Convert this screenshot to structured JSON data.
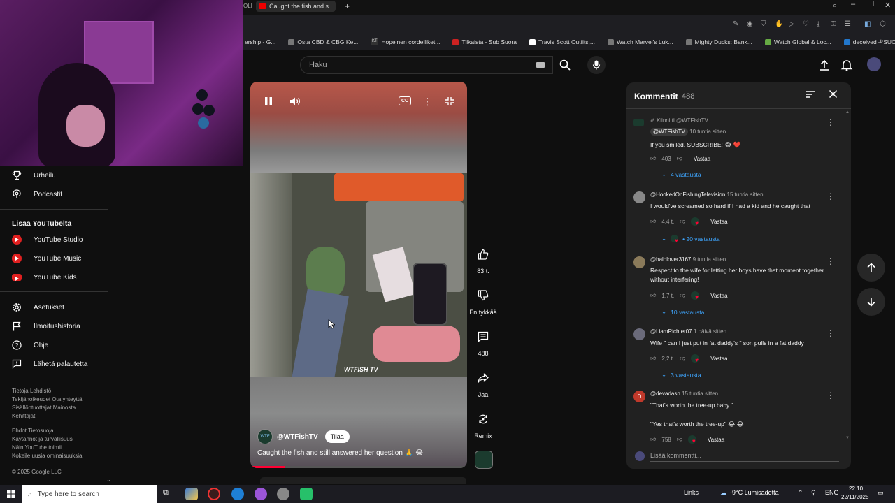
{
  "browser": {
    "tab_fragment": "OLI",
    "active_tab": "Caught the fish and s",
    "bookmarks": [
      "ership - G...",
      "Osta CBD & CBG Ke...",
      "Hopeinen cordelliket...",
      "Tilkaista - Sub Suora",
      "Travis Scott Outfits,...",
      "Watch Marvel's Luk...",
      "Mighty Ducks: Bank...",
      "Watch Global & Loc...",
      "deceived – SUORAT..."
    ],
    "bookmark_icons": [
      "",
      "",
      "KT",
      "",
      "",
      "",
      "",
      "",
      ""
    ]
  },
  "header": {
    "search_placeholder": "Haku"
  },
  "sidebar": {
    "top_items": [
      {
        "label": "Urheilu",
        "icon": "trophy-icon"
      },
      {
        "label": "Podcastit",
        "icon": "podcast-icon"
      }
    ],
    "more_heading": "Lisää YouTubelta",
    "more_items": [
      {
        "label": "YouTube Studio"
      },
      {
        "label": "YouTube Music"
      },
      {
        "label": "YouTube Kids"
      }
    ],
    "settings_items": [
      {
        "label": "Asetukset",
        "icon": "gear-icon"
      },
      {
        "label": "Ilmoitushistoria",
        "icon": "flag-icon"
      },
      {
        "label": "Ohje",
        "icon": "help-icon"
      },
      {
        "label": "Lähetä palautetta",
        "icon": "feedback-icon"
      }
    ],
    "footer_1": [
      "Tietoja  Lehdistö",
      "Tekijänoikeudet  Ota yhteyttä",
      "Sisällöntuottajat  Mainosta",
      "Kehittäjät"
    ],
    "footer_2": [
      "Ehdot  Tietosuoja",
      "Käytännöt ja turvallisuus",
      "Näin YouTube toimii",
      "Kokeile uusia ominaisuuksia"
    ],
    "copyright": "© 2025 Google LLC"
  },
  "video": {
    "cc_label": "CC",
    "watermark": "WTFISH TV",
    "channel_name": "@WTFishTV",
    "subscribe_label": "Tilaa",
    "title": "Caught the fish and still answered her question 🙏 😂",
    "progress": 0.16
  },
  "actions": {
    "likes": "83 t.",
    "dislike_label": "En tykkää",
    "comments": "488",
    "share_label": "Jaa",
    "remix_label": "Remix"
  },
  "comments": {
    "title": "Kommentit",
    "count": "488",
    "input_placeholder": "Lisää kommentti...",
    "items": [
      {
        "pinned": "Kiinnitti @WTFishTV",
        "author": "@WTFishTV",
        "time": "10 tuntia sitten",
        "text": "If you smiled, SUBSCRIBE! 😂 ❤️",
        "likes": "403",
        "reply_label": "Vastaa",
        "replies": "4 vastausta"
      },
      {
        "author": "@HookedOnFishingTelevision",
        "time": "15 tuntia sitten",
        "text": "I would've screamed so hard if I had a kid and he caught that",
        "likes": "4,4 t.",
        "reply_label": "Vastaa",
        "replies": "• 20 vastausta"
      },
      {
        "author": "@halolover3167",
        "time": "9 tuntia sitten",
        "text": "Respect to the wife for letting her boys have that moment together without interfering!",
        "likes": "1,7 t.",
        "reply_label": "Vastaa",
        "replies": "10 vastausta"
      },
      {
        "author": "@LiamRichter07",
        "time": "1 päivä sitten",
        "text": "Wife \" can I just put in fat daddy's \" son pulls in a fat daddy",
        "likes": "2,2 t.",
        "reply_label": "Vastaa",
        "replies": "3 vastausta"
      },
      {
        "author": "@devadasn",
        "avatar_letter": "D",
        "time": "15 tuntia sitten",
        "text": "\"That's worth the tree-up baby.\"",
        "text2": "\"Yes that's worth the tree-up\" 😂 😂",
        "likes": "758",
        "reply_label": "Vastaa"
      }
    ]
  },
  "taskbar": {
    "search_placeholder": "Type here to search",
    "links_label": "Links",
    "weather": "-9°C  Lumisadetta",
    "lang": "ENG",
    "time": "22.10",
    "date": "22/11/2025"
  },
  "colors": {
    "accent_red": "#ff0033",
    "link_blue": "#3ea6ff",
    "bg": "#0f0f0f",
    "panel": "#212121"
  }
}
